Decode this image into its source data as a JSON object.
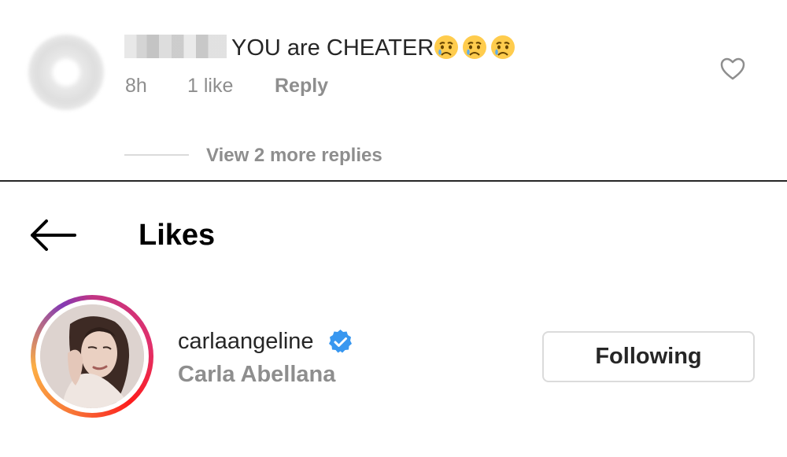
{
  "comment": {
    "text": "YOU are CHEATER",
    "emoji_icons": [
      "crying-face-icon",
      "crying-face-icon",
      "crying-face-icon"
    ],
    "time": "8h",
    "likes": "1 like",
    "reply_label": "Reply",
    "view_replies": "View 2 more replies"
  },
  "likes": {
    "title": "Likes",
    "user": {
      "username": "carlaangeline",
      "full_name": "Carla Abellana",
      "verified": true,
      "following_label": "Following"
    }
  },
  "colors": {
    "text_primary": "#262626",
    "text_secondary": "#8e8e8e",
    "verified_blue": "#3897f0",
    "border": "#dbdbdb"
  }
}
